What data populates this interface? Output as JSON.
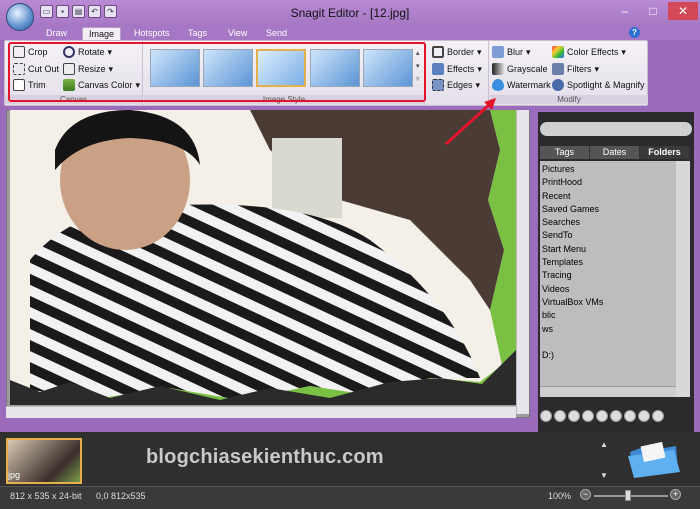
{
  "window": {
    "title": "Snagit Editor - [12.jpg]",
    "minimize": "–",
    "maximize": "□",
    "close": "✕"
  },
  "quick_access": [
    "folder-open-icon",
    "save-icon",
    "print-icon",
    "undo-icon",
    "redo-icon"
  ],
  "tabs": [
    {
      "label": "Draw"
    },
    {
      "label": "Image",
      "active": true
    },
    {
      "label": "Hotspots"
    },
    {
      "label": "Tags"
    },
    {
      "label": "View"
    },
    {
      "label": "Send"
    }
  ],
  "ribbon": {
    "canvas": {
      "label": "Canvas",
      "crop": "Crop",
      "cut_out": "Cut Out",
      "trim": "Trim",
      "rotate": "Rotate",
      "resize": "Resize",
      "canvas_color": "Canvas Color"
    },
    "image_style": {
      "label": "Image Style",
      "selected_index": 2
    },
    "border_group": {
      "border": "Border",
      "effects": "Effects",
      "edges": "Edges"
    },
    "modify": {
      "label": "Modify",
      "blur": "Blur",
      "grayscale": "Grayscale",
      "watermark": "Watermark",
      "color_effects": "Color Effects",
      "filters": "Filters",
      "spotlight_magnify": "Spotlight & Magnify"
    }
  },
  "panel": {
    "tabs": [
      {
        "label": "Tags"
      },
      {
        "label": "Dates"
      },
      {
        "label": "Folders",
        "active": true
      }
    ],
    "folders": [
      "Pictures",
      "PrintHood",
      "Recent",
      "Saved Games",
      "Searches",
      "SendTo",
      "Start Menu",
      "Templates",
      "Tracing",
      "Videos",
      "VirtualBox VMs",
      "blic",
      "ws",
      "",
      "D:)"
    ]
  },
  "tray": {
    "thumb_label": "jpg",
    "watermark": "blogchiasekienthuc.com"
  },
  "status": {
    "image_info": "812 x 535 x 24-bit",
    "coords": "0,0  812x535",
    "zoom": "100%",
    "zoom_minus": "−",
    "zoom_plus": "+"
  },
  "colors": {
    "accent": "#a677c4",
    "highlight_box": "#e4142a",
    "selected_style": "#e3b04a"
  }
}
